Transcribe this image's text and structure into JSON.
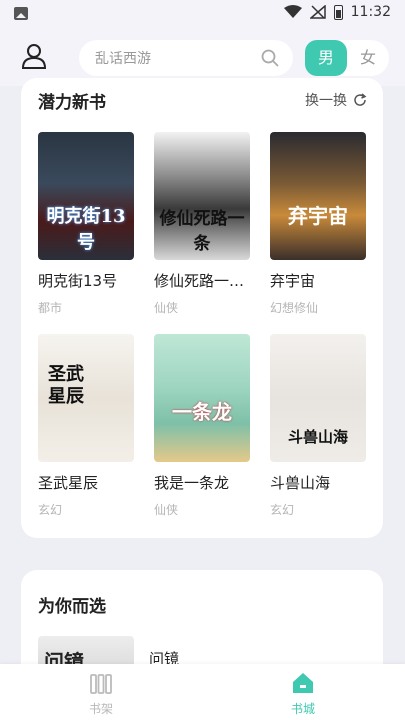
{
  "status": {
    "time": "11:32"
  },
  "search": {
    "placeholder": "乱话西游"
  },
  "gender": {
    "male": "男",
    "female": "女"
  },
  "section1": {
    "title": "潜力新书",
    "refresh": "换一换",
    "books": [
      {
        "name": "明克街13号",
        "genre": "都市",
        "cover_text": "明克街13号"
      },
      {
        "name": "修仙死路一…",
        "genre": "仙侠",
        "cover_text": "修仙死路一条"
      },
      {
        "name": "弃宇宙",
        "genre": "幻想修仙",
        "cover_text": "弃宇宙"
      },
      {
        "name": "圣武星辰",
        "genre": "玄幻",
        "cover_text": "圣武星辰"
      },
      {
        "name": "我是一条龙",
        "genre": "仙侠",
        "cover_text": "一条龙"
      },
      {
        "name": "斗兽山海",
        "genre": "玄幻",
        "cover_text": "斗兽山海"
      }
    ]
  },
  "section2": {
    "title": "为你而选",
    "book": {
      "name": "问镜",
      "cover_text": "问镜"
    }
  },
  "tabs": [
    {
      "label": "书架",
      "icon": "bookshelf-icon"
    },
    {
      "label": "书城",
      "icon": "home-icon"
    }
  ],
  "colors": {
    "accent": "#3ec9b0",
    "background": "#eeeef5"
  }
}
